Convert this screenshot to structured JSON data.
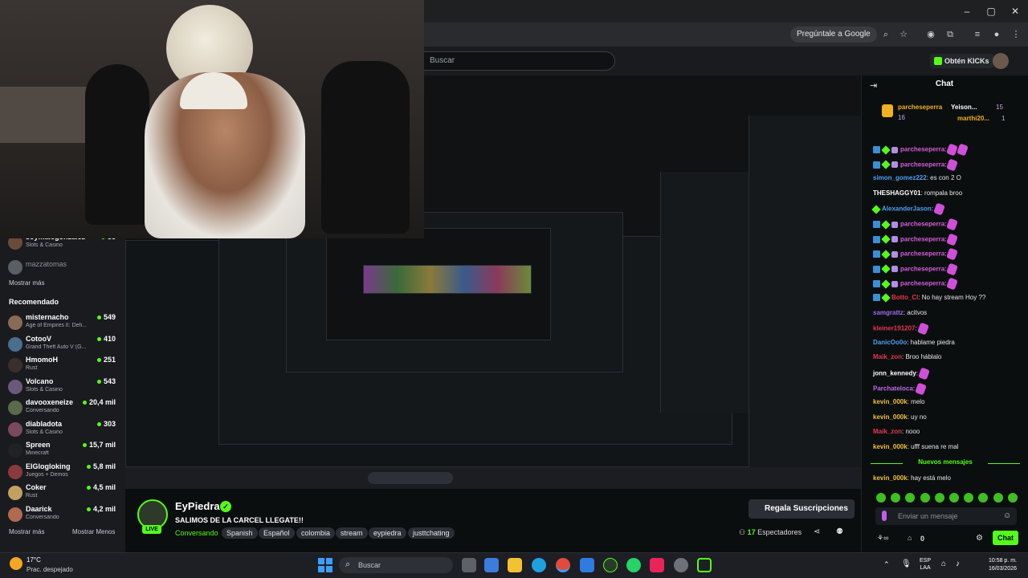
{
  "browser": {
    "ask_google": "Pregúntale a Google"
  },
  "kick": {
    "search_placeholder": "Buscar",
    "get_kicks": "Obtén KICKs"
  },
  "sidebar": {
    "top_partial": {
      "name": "soymalegonzalez",
      "category": "Slots & Casino",
      "count": "35"
    },
    "offline": "mazzatomas",
    "show_more_1": "Mostrar más",
    "recommended_label": "Recomendado",
    "items": [
      {
        "name": "misternacho",
        "category": "Age of Empires II: Defi...",
        "count": "549",
        "color": "#8a6a55"
      },
      {
        "name": "CotooV",
        "category": "Grand Theft Auto V (G...",
        "count": "410",
        "color": "#4a6f8c"
      },
      {
        "name": "HmomoH",
        "category": "Rust",
        "count": "251",
        "color": "#3a2f2a"
      },
      {
        "name": "Volcano",
        "category": "Slots & Casino",
        "count": "543",
        "color": "#6a5a7a"
      },
      {
        "name": "davooxeneize",
        "category": "Conversando",
        "count": "20,4 mil",
        "color": "#5a6a4a"
      },
      {
        "name": "diabladota",
        "category": "Slots & Casino",
        "count": "303",
        "color": "#7a4a5a"
      },
      {
        "name": "Spreen",
        "category": "Minecraft",
        "count": "15,7 mil",
        "color": "#222"
      },
      {
        "name": "ElGlogloking",
        "category": "Juegos + Demos",
        "count": "5,8 mil",
        "color": "#8a3a3a"
      },
      {
        "name": "Coker",
        "category": "Rust",
        "count": "4,5 mil",
        "color": "#c4a060"
      },
      {
        "name": "Daarick",
        "category": "Conversando",
        "count": "4,2 mil",
        "color": "#b06a50"
      }
    ],
    "show_more_2": "Mostrar más",
    "show_less": "Mostrar Menos"
  },
  "stream": {
    "streamer": "EyPiedra",
    "live": "LIVE",
    "title": "SALIMOS DE LA CARCEL LLEGATE!!",
    "category": "Conversando",
    "tags": [
      "Spanish",
      "Español",
      "colombia",
      "stream",
      "eypiedra",
      "justtchating"
    ],
    "gift_subs": "Regala Suscripciones",
    "viewers_count": "17",
    "viewers_label": "Espectadores"
  },
  "chat": {
    "title": "Chat",
    "pinned": [
      {
        "name": "parcheseperra",
        "value": "16"
      },
      {
        "name": "Yeison...",
        "value": "15"
      },
      {
        "name": "marthi20...",
        "value": "1"
      }
    ],
    "messages": [
      {
        "user": "parcheseperra",
        "color": "#d35ed8",
        "text": ":",
        "emotes": 2,
        "badges": true
      },
      {
        "user": "parcheseperra",
        "color": "#d35ed8",
        "text": ":",
        "emotes": 1,
        "badges": true
      },
      {
        "user": "simon_gomez222",
        "color": "#4f9ef5",
        "text": ": es con 2 O",
        "emotes": 0,
        "badges": false
      },
      {
        "user": "THESHAGGY01",
        "color": "#ffffff",
        "text": ": rompala broo",
        "emotes": 0,
        "badges": false
      },
      {
        "user": "AlexanderJason",
        "color": "#4f9ef5",
        "text": ":",
        "emotes": 1,
        "badges": false,
        "green": true
      },
      {
        "user": "parcheseperra",
        "color": "#d35ed8",
        "text": ":",
        "emotes": 1,
        "badges": true
      },
      {
        "user": "parcheseperra",
        "color": "#d35ed8",
        "text": ":",
        "emotes": 1,
        "badges": true
      },
      {
        "user": "parcheseperra",
        "color": "#d35ed8",
        "text": ":",
        "emotes": 1,
        "badges": true
      },
      {
        "user": "parcheseperra",
        "color": "#d35ed8",
        "text": ":",
        "emotes": 1,
        "badges": true
      },
      {
        "user": "parcheseperra",
        "color": "#d35ed8",
        "text": ":",
        "emotes": 1,
        "badges": true
      },
      {
        "user": "Botto_Cl",
        "color": "#e8364f",
        "text": ": No hay stream Hoy ??",
        "emotes": 0,
        "badges": false,
        "greenblue": true
      },
      {
        "user": "samgrattz",
        "color": "#9a6cf0",
        "text": ": acitvos",
        "emotes": 0,
        "badges": false
      },
      {
        "user": "kleiner191207",
        "color": "#e8364f",
        "text": ":",
        "emotes": 1,
        "badges": false
      },
      {
        "user": "DanicOo0o",
        "color": "#4f9ef5",
        "text": ": hablame piedra",
        "emotes": 0,
        "badges": false
      },
      {
        "user": "Maik_zon",
        "color": "#e8364f",
        "text": ": Broo háblalo",
        "emotes": 0,
        "badges": false
      },
      {
        "user": "jonn_kennedy",
        "color": "#ffffff",
        "text": ":",
        "emotes": 1,
        "badges": false
      },
      {
        "user": "Parchateloca",
        "color": "#c26ae8",
        "text": ":",
        "emotes": 1,
        "badges": false
      },
      {
        "user": "kevin_000k",
        "color": "#f0c040",
        "text": ": melo",
        "emotes": 0,
        "badges": false
      },
      {
        "user": "kevin_000k",
        "color": "#f0c040",
        "text": ": uy no",
        "emotes": 0,
        "badges": false
      },
      {
        "user": "Maik_zon",
        "color": "#e8364f",
        "text": ": nooo",
        "emotes": 0,
        "badges": false
      },
      {
        "user": "kevin_000k",
        "color": "#f0c040",
        "text": ": ufff suena re mal",
        "emotes": 0,
        "badges": false
      }
    ],
    "new_messages": "Nuevos mensajes",
    "after_new": [
      {
        "user": "kevin_000k",
        "color": "#f0c040",
        "text": ": hay está melo"
      }
    ],
    "input_placeholder": "Enviar un mensaje",
    "points_value": "0",
    "send_label": "Chat"
  },
  "taskbar": {
    "weather_temp": "17°C",
    "weather_desc": "Prac. despejado",
    "search_placeholder": "Buscar",
    "lang_1": "ESP",
    "lang_2": "LAA",
    "time": "10:58 p. m.",
    "date": "16/03/2026"
  }
}
